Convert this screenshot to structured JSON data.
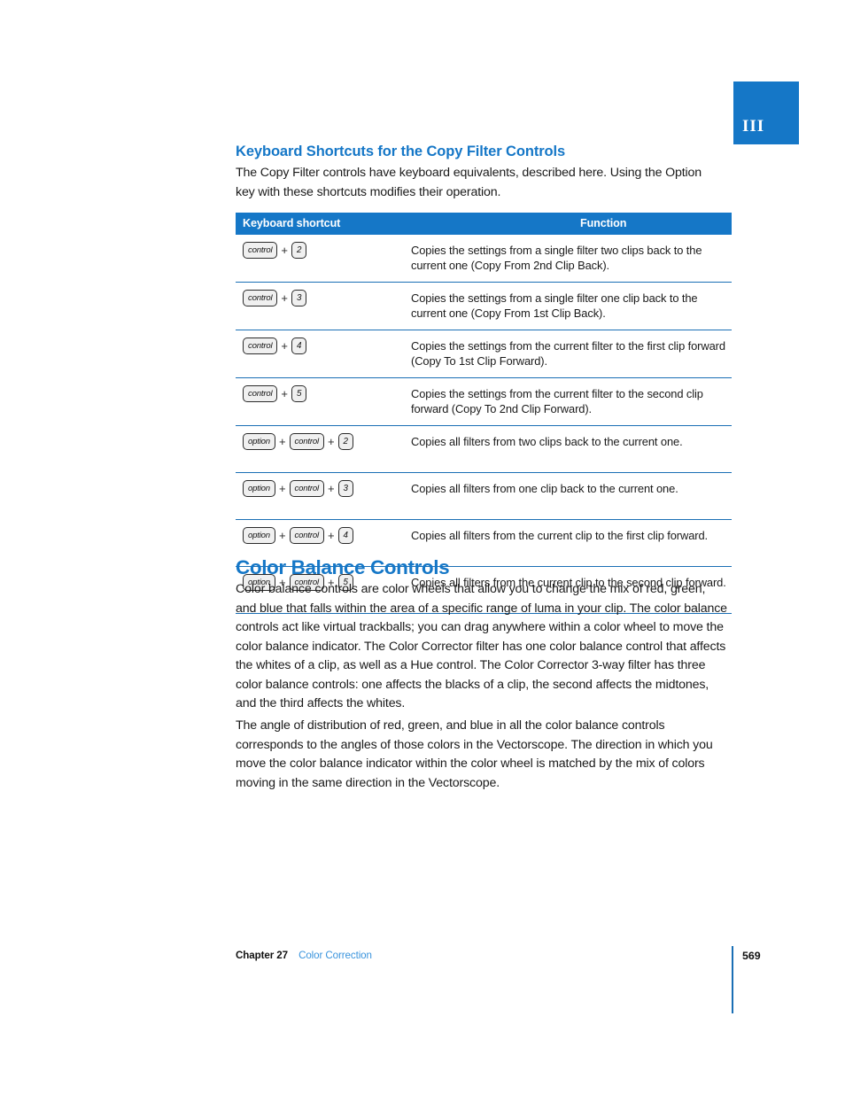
{
  "part_tab": {
    "label": "III"
  },
  "section": {
    "title": "Keyboard Shortcuts for the Copy Filter Controls",
    "intro": "The Copy Filter controls have keyboard equivalents, described here. Using the Option key with these shortcuts modifies their operation."
  },
  "table": {
    "headers": {
      "shortcut": "Keyboard shortcut",
      "function": "Function"
    },
    "plus": "+",
    "rows": [
      {
        "keys": [
          "control",
          "2"
        ],
        "function": "Copies the settings from a single filter two clips back to the current one (Copy From 2nd Clip Back)."
      },
      {
        "keys": [
          "control",
          "3"
        ],
        "function": "Copies the settings from a single filter one clip back to the current one (Copy From 1st Clip Back)."
      },
      {
        "keys": [
          "control",
          "4"
        ],
        "function": "Copies the settings from the current filter to the first clip forward (Copy To 1st Clip Forward)."
      },
      {
        "keys": [
          "control",
          "5"
        ],
        "function": "Copies the settings from the current filter to the second clip forward (Copy To 2nd Clip Forward)."
      },
      {
        "keys": [
          "option",
          "control",
          "2"
        ],
        "function": "Copies all filters from two clips back to the current one."
      },
      {
        "keys": [
          "option",
          "control",
          "3"
        ],
        "function": "Copies all filters from one clip back to the current one."
      },
      {
        "keys": [
          "option",
          "control",
          "4"
        ],
        "function": "Copies all filters from the current clip to the first clip forward."
      },
      {
        "keys": [
          "option",
          "control",
          "5"
        ],
        "function": "Copies all filters from the current clip to the second clip forward."
      }
    ]
  },
  "body": {
    "title": "Color Balance Controls",
    "paragraph_1": "Color balance controls are color wheels that allow you to change the mix of red, green, and blue that falls within the area of a specific range of luma in your clip. The color balance controls act like virtual trackballs; you can drag anywhere within a color wheel to move the color balance indicator. The Color Corrector filter has one color balance control that affects the whites of a clip, as well as a Hue control. The Color Corrector 3-way filter has three color balance controls: one affects the blacks of a clip, the second affects the midtones, and the third affects the whites.",
    "paragraph_2": "The angle of distribution of red, green, and blue in all the color balance controls corresponds to the angles of those colors in the Vectorscope. The direction in which you move the color balance indicator within the color wheel is matched by the mix of colors moving in the same direction in the Vectorscope."
  },
  "footer": {
    "chapter_label": "Chapter 27",
    "chapter_name": "Color Correction",
    "page_number": "569"
  },
  "colors": {
    "accent_blue": "#1577c7",
    "link_blue": "#3a94dd",
    "rule_blue": "#1a6fb5",
    "text": "#1a1a1a"
  }
}
